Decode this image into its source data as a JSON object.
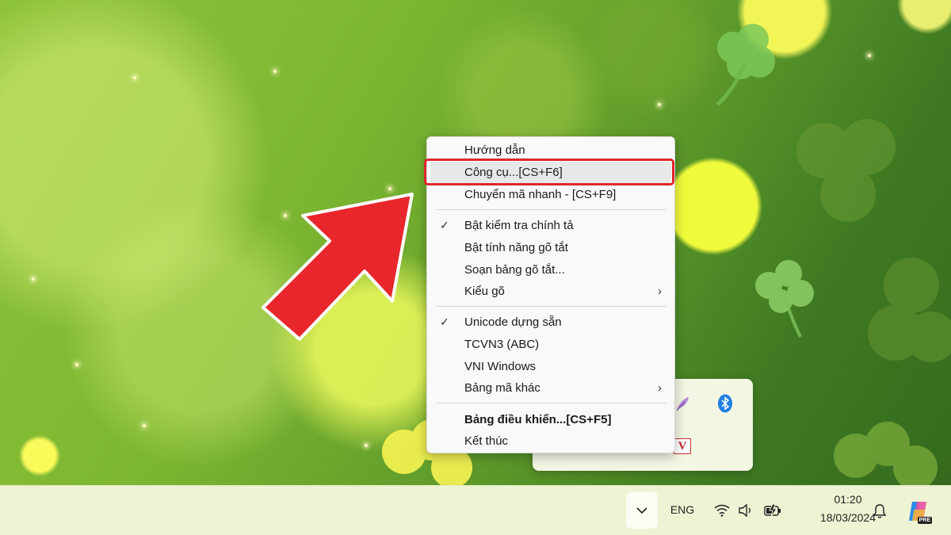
{
  "context_menu": {
    "items": [
      {
        "label": "Hướng dẫn"
      },
      {
        "label": "Công cụ...[CS+F6]"
      },
      {
        "label": "Chuyển mã nhanh - [CS+F9]"
      },
      {
        "label": "Bật kiểm tra chính tả",
        "checked": true
      },
      {
        "label": "Bật tính năng gõ tắt"
      },
      {
        "label": "Soạn bảng gõ tắt..."
      },
      {
        "label": "Kiểu gõ",
        "submenu": true
      },
      {
        "label": "Unicode dựng sẵn",
        "checked": true
      },
      {
        "label": "TCVN3 (ABC)"
      },
      {
        "label": "VNI Windows"
      },
      {
        "label": "Bảng mã khác",
        "submenu": true
      },
      {
        "label": "Bảng điều khiển...[CS+F5]",
        "bold": true
      },
      {
        "label": "Kết thúc"
      }
    ],
    "check_glyph": "✓",
    "submenu_glyph": "›",
    "highlighted_item": "Công cụ...[CS+F6]"
  },
  "taskbar": {
    "language": "ENG",
    "time": "01:20",
    "date": "18/03/2024",
    "copilot_badge": "PRE",
    "icons": [
      "chevron-up-icon",
      "wifi-icon",
      "speaker-icon",
      "battery-charging-icon",
      "bell-icon",
      "copilot-icon"
    ]
  },
  "tray_flyout": {
    "icons": [
      "feather-icon",
      "bluetooth-icon",
      "vietkey-v-icon"
    ],
    "vietkey_letter": "V"
  },
  "annotation": {
    "arrow_color": "#e8262c",
    "highlight_color": "#e0262c"
  }
}
